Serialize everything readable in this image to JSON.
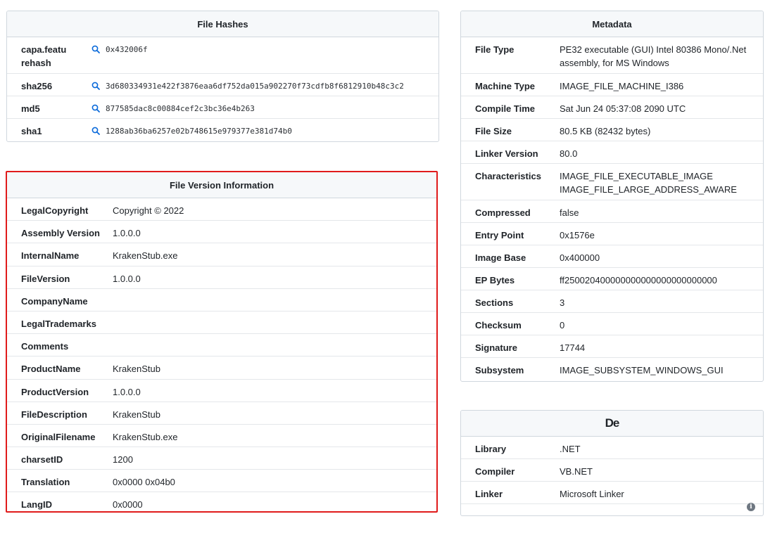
{
  "file_hashes": {
    "title": "File Hashes",
    "rows": [
      {
        "key": "capa.featu\nrehash",
        "value": "0x432006f"
      },
      {
        "key": "sha256",
        "value": "3d680334931e422f3876eaa6df752da015a902270f73cdfb8f6812910b48c3c2"
      },
      {
        "key": "md5",
        "value": "877585dac8c00884cef2c3bc36e4b263"
      },
      {
        "key": "sha1",
        "value": "1288ab36ba6257e02b748615e979377e381d74b0"
      }
    ]
  },
  "version_info": {
    "title": "File Version Information",
    "rows": [
      {
        "key": "LegalCopyright",
        "value": "Copyright © 2022"
      },
      {
        "key": "Assembly Version",
        "value": "1.0.0.0"
      },
      {
        "key": "InternalName",
        "value": "KrakenStub.exe"
      },
      {
        "key": "FileVersion",
        "value": "1.0.0.0"
      },
      {
        "key": "CompanyName",
        "value": ""
      },
      {
        "key": "LegalTrademarks",
        "value": ""
      },
      {
        "key": "Comments",
        "value": ""
      },
      {
        "key": "ProductName",
        "value": "KrakenStub"
      },
      {
        "key": "ProductVersion",
        "value": "1.0.0.0"
      },
      {
        "key": "FileDescription",
        "value": "KrakenStub"
      },
      {
        "key": "OriginalFilename",
        "value": "KrakenStub.exe"
      },
      {
        "key": "charsetID",
        "value": "1200"
      },
      {
        "key": "Translation",
        "value": "0x0000 0x04b0"
      },
      {
        "key": "LangID",
        "value": "0x0000"
      }
    ]
  },
  "metadata": {
    "title": "Metadata",
    "rows": [
      {
        "key": "File Type",
        "value": "PE32 executable (GUI) Intel 80386 Mono/.Net assembly, for MS Windows"
      },
      {
        "key": "Machine Type",
        "value": "IMAGE_FILE_MACHINE_I386"
      },
      {
        "key": "Compile Time",
        "value": "Sat Jun 24 05:37:08 2090 UTC"
      },
      {
        "key": "File Size",
        "value": "80.5 KB (82432 bytes)"
      },
      {
        "key": "Linker Version",
        "value": "80.0"
      },
      {
        "key": "Characteristics",
        "value": "IMAGE_FILE_EXECUTABLE_IMAGE IMAGE_FILE_LARGE_ADDRESS_AWARE"
      },
      {
        "key": "Compressed",
        "value": "false"
      },
      {
        "key": "Entry Point",
        "value": "0x1576e"
      },
      {
        "key": "Image Base",
        "value": "0x400000"
      },
      {
        "key": "EP Bytes",
        "value": "ff250020400000000000000000000000"
      },
      {
        "key": "Sections",
        "value": "3"
      },
      {
        "key": "Checksum",
        "value": "0"
      },
      {
        "key": "Signature",
        "value": "17744"
      },
      {
        "key": "Subsystem",
        "value": "IMAGE_SUBSYSTEM_WINDOWS_GUI"
      }
    ]
  },
  "detect_it_easy": {
    "logo_text": "De",
    "rows": [
      {
        "key": "Library",
        "value": ".NET"
      },
      {
        "key": "Compiler",
        "value": "VB.NET"
      },
      {
        "key": "Linker",
        "value": "Microsoft Linker"
      }
    ],
    "info_icon": "i"
  },
  "icons": {
    "search": "search-icon",
    "info": "info-icon"
  },
  "colors": {
    "highlight_border": "#e01b1b",
    "search_icon": "#0969da"
  }
}
